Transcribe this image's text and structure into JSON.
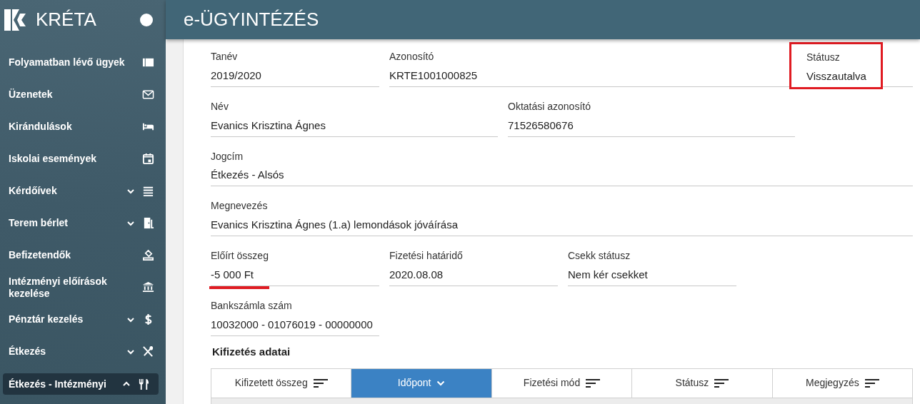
{
  "app": {
    "name": "KRÉTA"
  },
  "sidebar": {
    "items": [
      {
        "label": "Folyamatban lévő ügyek",
        "kind": "link",
        "selected": false
      },
      {
        "label": "Üzenetek",
        "kind": "link",
        "selected": false
      },
      {
        "label": "Kirándulások",
        "kind": "link",
        "selected": false
      },
      {
        "label": "Iskolai események",
        "kind": "link",
        "selected": false
      },
      {
        "label": "Kérdőívek",
        "kind": "group",
        "expanded": false,
        "selected": false
      },
      {
        "label": "Terem bérlet",
        "kind": "group",
        "expanded": false,
        "selected": false
      },
      {
        "label": "Befizetendők",
        "kind": "link",
        "selected": false
      },
      {
        "label": "Intézményi előírások kezelése",
        "kind": "link",
        "selected": false
      },
      {
        "label": "Pénztár kezelés",
        "kind": "group",
        "expanded": false,
        "selected": false
      },
      {
        "label": "Étkezés",
        "kind": "group",
        "expanded": false,
        "selected": false
      },
      {
        "label": "Étkezés - Intézményi",
        "kind": "group",
        "expanded": true,
        "selected": true
      }
    ]
  },
  "page": {
    "title": "e-ÜGYINTÉZÉS"
  },
  "form": {
    "rows": [
      [
        {
          "label": "Tanév",
          "value": "2019/2020",
          "highlighted": false,
          "underlined": false
        },
        {
          "label": "Azonosító",
          "value": "KRTE1001000825",
          "highlighted": false,
          "underlined": false
        },
        {
          "label": "Státusz",
          "value": "Visszautalva",
          "highlighted": true,
          "underlined": false
        }
      ],
      [
        {
          "label": "Név",
          "value": "Evanics Krisztina Ágnes",
          "highlighted": false,
          "underlined": false
        },
        {
          "label": "Oktatási azonosító",
          "value": "71526580676",
          "highlighted": false,
          "underlined": false
        }
      ],
      [
        {
          "label": "Jogcím",
          "value": "Étkezés - Alsós",
          "highlighted": false,
          "underlined": false
        }
      ],
      [
        {
          "label": "Megnevezés",
          "value": "Evanics Krisztina Ágnes (1.a) lemondások jóváírása",
          "highlighted": false,
          "underlined": false
        }
      ],
      [
        {
          "label": "Előírt összeg",
          "value": "-5 000 Ft",
          "highlighted": false,
          "underlined": true
        },
        {
          "label": "Fizetési határidő",
          "value": "2020.08.08",
          "highlighted": false,
          "underlined": false
        },
        {
          "label": "Csekk státusz",
          "value": "Nem kér csekket",
          "highlighted": false,
          "underlined": false
        }
      ],
      [
        {
          "label": "Bankszámla szám",
          "value": "10032000 - 01076019 - 00000000",
          "highlighted": false,
          "underlined": false
        }
      ]
    ]
  },
  "payments": {
    "title": "Kifizetés adatai",
    "columns": [
      {
        "label": "Kifizetett összeg",
        "selected": false
      },
      {
        "label": "Időpont",
        "selected": true
      },
      {
        "label": "Fizetési mód",
        "selected": false
      },
      {
        "label": "Státusz",
        "selected": false
      },
      {
        "label": "Megjegyzés",
        "selected": false
      }
    ]
  }
}
